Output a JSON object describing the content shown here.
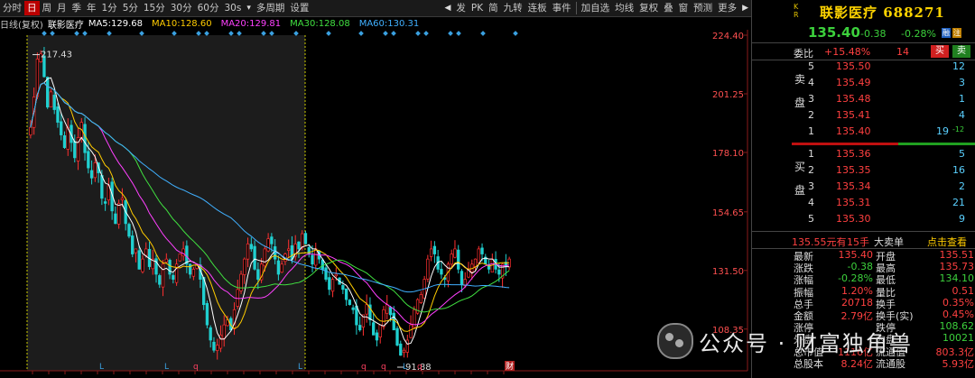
{
  "toolbar": {
    "periods": [
      "分时",
      "日",
      "周",
      "月",
      "季",
      "年",
      "1分",
      "5分",
      "15分",
      "30分",
      "60分",
      "30s",
      "多周期",
      "设置"
    ],
    "active_period": "日",
    "tools": [
      "发",
      "PK",
      "简",
      "九转",
      "连板",
      "事件",
      "加自选",
      "均线",
      "复权",
      "叠",
      "窗",
      "预测",
      "更多"
    ]
  },
  "info_bar": {
    "chart_type": "日线(复权)",
    "stock": "联影医疗",
    "ma": [
      {
        "label": "MA5:",
        "value": "129.68",
        "color": "#ffffff"
      },
      {
        "label": "MA10:",
        "value": "128.60",
        "color": "#ffcc00"
      },
      {
        "label": "MA20:",
        "value": "129.81",
        "color": "#ff40ff"
      },
      {
        "label": "MA30:",
        "value": "128.08",
        "color": "#40e040"
      },
      {
        "label": "MA60:",
        "value": "130.31",
        "color": "#40b0ff"
      }
    ]
  },
  "chart_data": {
    "type": "candlestick",
    "y_axis_labels": [
      "224.40",
      "201.25",
      "178.10",
      "154.65",
      "131.50",
      "108.35"
    ],
    "ylim": [
      91.88,
      224.4
    ],
    "max_label": "217.43",
    "min_label": "91.88",
    "x_markers": [
      "L",
      "L",
      "q",
      "L",
      "q",
      "q",
      "L",
      "q"
    ],
    "last_marker": "财",
    "close_path": [
      188,
      200,
      215,
      217,
      208,
      196,
      202,
      195,
      190,
      185,
      180,
      188,
      182,
      176,
      184,
      190,
      178,
      172,
      168,
      174,
      170,
      160,
      158,
      165,
      155,
      150,
      158,
      160,
      150,
      145,
      138,
      140,
      132,
      136,
      140,
      133,
      136,
      130,
      126,
      134,
      136,
      130,
      128,
      134,
      138,
      140,
      134,
      130,
      132,
      134,
      128,
      118,
      110,
      104,
      100,
      102,
      106,
      110,
      112,
      108,
      116,
      124,
      130,
      136,
      142,
      140,
      132,
      128,
      134,
      140,
      144,
      142,
      136,
      130,
      134,
      138,
      140,
      136,
      142,
      140,
      146,
      142,
      138,
      134,
      140,
      136,
      132,
      128,
      124,
      128,
      130,
      126,
      124,
      120,
      118,
      116,
      110,
      108,
      114,
      118,
      112,
      106,
      104,
      110,
      116,
      118,
      114,
      108,
      102,
      98,
      100,
      104,
      110,
      116,
      120,
      122,
      128,
      136,
      140,
      138,
      132,
      130,
      128,
      134,
      138,
      140,
      132,
      126,
      128,
      132,
      134,
      136,
      140,
      138,
      134,
      132,
      136,
      132,
      130,
      134,
      133,
      136
    ]
  },
  "sidebar": {
    "market_tag": "K\nR",
    "stock_name": "联影医疗",
    "stock_code": "688271",
    "price": "135.40",
    "change": "-0.38",
    "change_pct": "-0.28%",
    "tag_rz": "融",
    "tag_rq": "注",
    "weibi_label": "委比",
    "weibi_value": "+15.48%",
    "weicha_value": "14",
    "buy_label": "买",
    "sell_label": "卖",
    "sell_side_label": "卖盘",
    "buy_side_label": "买盘",
    "asks": [
      {
        "level": "5",
        "price": "135.50",
        "vol": "12"
      },
      {
        "level": "4",
        "price": "135.49",
        "vol": "3"
      },
      {
        "level": "3",
        "price": "135.48",
        "vol": "1"
      },
      {
        "level": "2",
        "price": "135.41",
        "vol": "4"
      },
      {
        "level": "1",
        "price": "135.40",
        "vol": "19",
        "extra": "-12"
      }
    ],
    "bids": [
      {
        "level": "1",
        "price": "135.36",
        "vol": "5"
      },
      {
        "level": "2",
        "price": "135.35",
        "vol": "16"
      },
      {
        "level": "3",
        "price": "135.34",
        "vol": "2"
      },
      {
        "level": "4",
        "price": "135.31",
        "vol": "21"
      },
      {
        "level": "5",
        "price": "135.30",
        "vol": "9"
      }
    ],
    "big_order": {
      "amount": "135.55元有",
      "hands": "15手",
      "label": "大卖单",
      "link": "点击查看"
    },
    "stats": [
      {
        "l1": "最新",
        "v1": "135.40",
        "c1": "red",
        "l2": "开盘",
        "v2": "135.51",
        "c2": "red"
      },
      {
        "l1": "涨跌",
        "v1": "-0.38",
        "c1": "green",
        "l2": "最高",
        "v2": "135.73",
        "c2": "red"
      },
      {
        "l1": "涨幅",
        "v1": "-0.28%",
        "c1": "green",
        "l2": "最低",
        "v2": "134.10",
        "c2": "green"
      },
      {
        "l1": "振幅",
        "v1": "1.20%",
        "c1": "red",
        "l2": "量比",
        "v2": "0.51",
        "c2": "red"
      },
      {
        "l1": "总手",
        "v1": "20718",
        "c1": "red",
        "l2": "换手",
        "v2": "0.35%",
        "c2": "red"
      },
      {
        "l1": "金额",
        "v1": "2.79亿",
        "c1": "red",
        "l2": "换手(实)",
        "v2": "0.45%",
        "c2": "red"
      },
      {
        "l1": "涨停",
        "v1": "",
        "c1": "red",
        "l2": "跌停",
        "v2": "108.62",
        "c2": "green"
      },
      {
        "l1": "外盘",
        "v1": "",
        "c1": "red",
        "l2": "内盘",
        "v2": "10021",
        "c2": "green"
      },
      {
        "l1": "总市值",
        "v1": "1116亿",
        "c1": "red",
        "l2": "流通值",
        "v2": "803.3亿",
        "c2": "red"
      },
      {
        "l1": "总股本",
        "v1": "8.24亿",
        "c1": "red",
        "l2": "流通股",
        "v2": "5.93亿",
        "c2": "red"
      }
    ]
  },
  "watermark": {
    "text": "公众号 · 财富独角兽"
  }
}
